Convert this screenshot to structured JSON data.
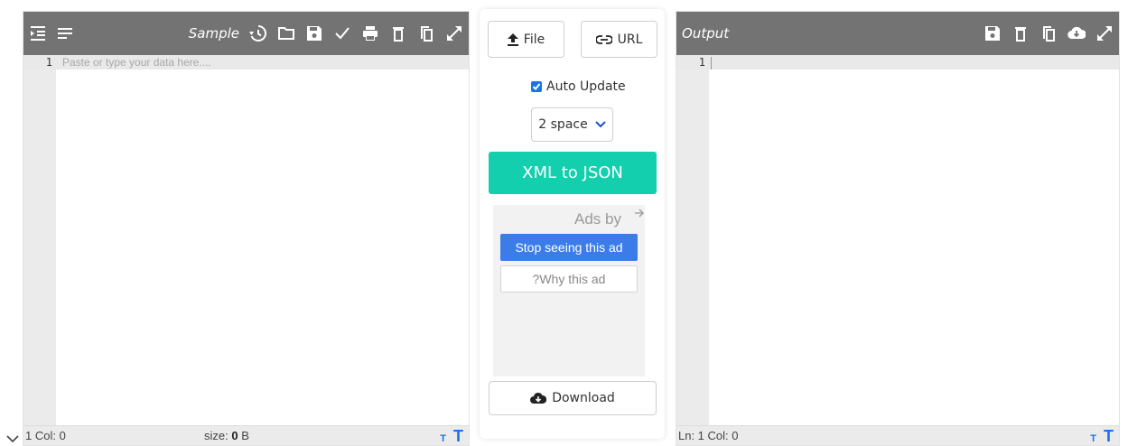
{
  "left_panel": {
    "sample_label": "Sample",
    "line_number": "1",
    "placeholder": "Paste or type your data here....",
    "status_position": "1 Col: 0",
    "status_size_label": "size:",
    "status_size_value": "0",
    "status_size_unit": "B",
    "font_small": "T",
    "font_big": "T"
  },
  "middle": {
    "file_label": "File",
    "url_label": "URL",
    "auto_update_label": "Auto Update",
    "auto_update_checked": true,
    "indent_value": "2 space",
    "convert_label": "XML to JSON",
    "ads_by_label": "Ads by",
    "stop_ad_label": "Stop seeing this ad",
    "why_ad_label": "?Why this ad",
    "download_label": "Download"
  },
  "right_panel": {
    "output_label": "Output",
    "line_number": "1",
    "status_position": "Ln: 1 Col: 0",
    "font_small": "T",
    "font_big": "T"
  },
  "colors": {
    "toolbar": "#737373",
    "accent_teal": "#13cfad",
    "link_blue": "#1a73e8"
  },
  "icons": {
    "left_toolbar": [
      "indent-icon",
      "format-lines-icon",
      "history-icon",
      "folder-icon",
      "save-icon",
      "validate-check-icon",
      "print-icon",
      "trash-icon",
      "copy-icon",
      "fullscreen-icon"
    ],
    "right_toolbar": [
      "save-icon",
      "trash-icon",
      "copy-icon",
      "cloud-download-icon",
      "fullscreen-icon"
    ]
  }
}
